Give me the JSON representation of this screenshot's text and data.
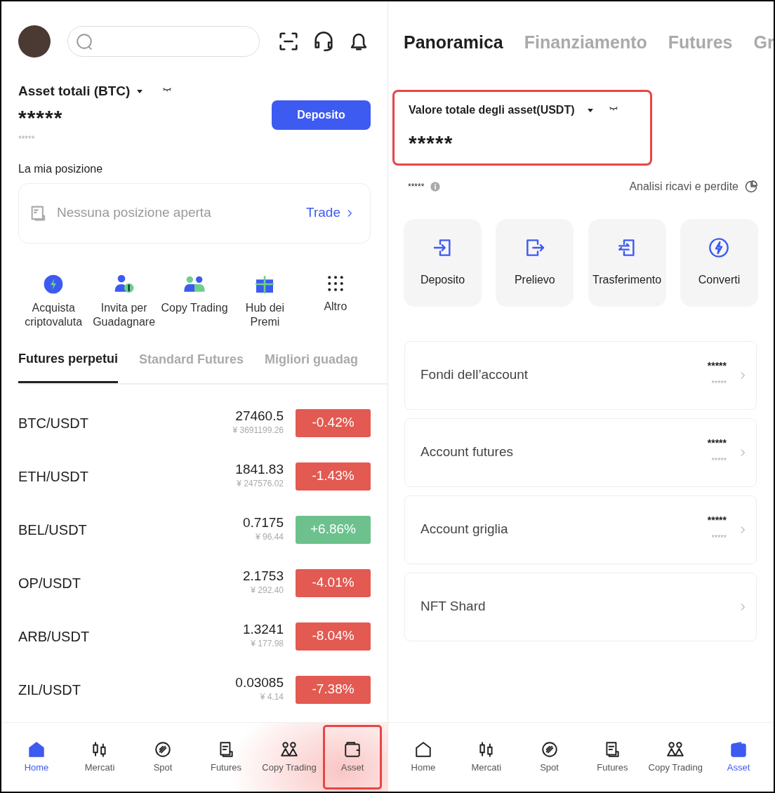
{
  "home_screen": {
    "total_assets": {
      "label": "Asset totali (BTC)",
      "value": "*****",
      "sub_value": "*****"
    },
    "deposit_button": "Deposito",
    "position": {
      "title": "La mia posizione",
      "empty_text": "Nessuna posizione aperta",
      "link": "Trade"
    },
    "shortcuts": [
      {
        "label": "Acquista criptovaluta",
        "kind": "buy"
      },
      {
        "label": "Invita per Guadagnare",
        "kind": "invite"
      },
      {
        "label": "Copy Trading",
        "kind": "copy"
      },
      {
        "label": "Hub dei Premi",
        "kind": "gift"
      },
      {
        "label": "Altro",
        "kind": "more"
      }
    ],
    "market_tabs": [
      {
        "label": "Futures perpetui",
        "selected": true
      },
      {
        "label": "Standard Futures",
        "selected": false
      },
      {
        "label": "Migliori guadag",
        "selected": false
      }
    ],
    "market_rows": [
      {
        "pair": "BTC/USDT",
        "price": "27460.5",
        "fiat": "¥ 3691199.26",
        "change": "-0.42%",
        "color": "#e25a51"
      },
      {
        "pair": "ETH/USDT",
        "price": "1841.83",
        "fiat": "¥ 247576.02",
        "change": "-1.43%",
        "color": "#e25a51"
      },
      {
        "pair": "BEL/USDT",
        "price": "0.7175",
        "fiat": "¥ 96.44",
        "change": "+6.86%",
        "color": "#6cc18c"
      },
      {
        "pair": "OP/USDT",
        "price": "2.1753",
        "fiat": "¥ 292.40",
        "change": "-4.01%",
        "color": "#e25a51"
      },
      {
        "pair": "ARB/USDT",
        "price": "1.3241",
        "fiat": "¥ 177.98",
        "change": "-8.04%",
        "color": "#e25a51"
      },
      {
        "pair": "ZIL/USDT",
        "price": "0.03085",
        "fiat": "¥ 4.14",
        "change": "-7.38%",
        "color": "#e25a51"
      }
    ],
    "bottom_nav": [
      {
        "label": "Home",
        "kind": "home",
        "selected": true,
        "highlighted": false
      },
      {
        "label": "Mercati",
        "kind": "markets",
        "selected": false,
        "highlighted": false
      },
      {
        "label": "Spot",
        "kind": "spot",
        "selected": false,
        "highlighted": false
      },
      {
        "label": "Futures",
        "kind": "futures",
        "selected": false,
        "highlighted": false
      },
      {
        "label": "Copy Trading",
        "kind": "copy",
        "selected": false,
        "highlighted": false
      },
      {
        "label": "Asset",
        "kind": "asset",
        "selected": false,
        "highlighted": true
      }
    ]
  },
  "asset_screen": {
    "tabs": [
      {
        "label": "Panoramica",
        "selected": true
      },
      {
        "label": "Finanziamento",
        "selected": false
      },
      {
        "label": "Futures",
        "selected": false
      },
      {
        "label": "Gr",
        "selected": false
      }
    ],
    "total": {
      "label": "Valore totale degli asset(USDT)",
      "value": "*****",
      "highlighted": true
    },
    "sub_value": "*****",
    "pnl_link": "Analisi ricavi e perdite",
    "actions": [
      {
        "label": "Deposito",
        "kind": "deposit"
      },
      {
        "label": "Prelievo",
        "kind": "withdraw"
      },
      {
        "label": "Trasferimento",
        "kind": "transfer"
      },
      {
        "label": "Converti",
        "kind": "convert"
      }
    ],
    "accounts": [
      {
        "name": "Fondi dell’account",
        "value": "*****",
        "sub_value": "*****"
      },
      {
        "name": "Account futures",
        "value": "*****",
        "sub_value": "*****"
      },
      {
        "name": "Account griglia",
        "value": "*****",
        "sub_value": "*****"
      },
      {
        "name": "NFT Shard"
      }
    ],
    "bottom_nav": [
      {
        "label": "Home",
        "kind": "home",
        "selected": false,
        "highlighted": false
      },
      {
        "label": "Mercati",
        "kind": "markets",
        "selected": false,
        "highlighted": false
      },
      {
        "label": "Spot",
        "kind": "spot",
        "selected": false,
        "highlighted": false
      },
      {
        "label": "Futures",
        "kind": "futures",
        "selected": false,
        "highlighted": false
      },
      {
        "label": "Copy Trading",
        "kind": "copy",
        "selected": false,
        "highlighted": false
      },
      {
        "label": "Asset",
        "kind": "asset",
        "selected": true,
        "highlighted": false
      }
    ]
  }
}
